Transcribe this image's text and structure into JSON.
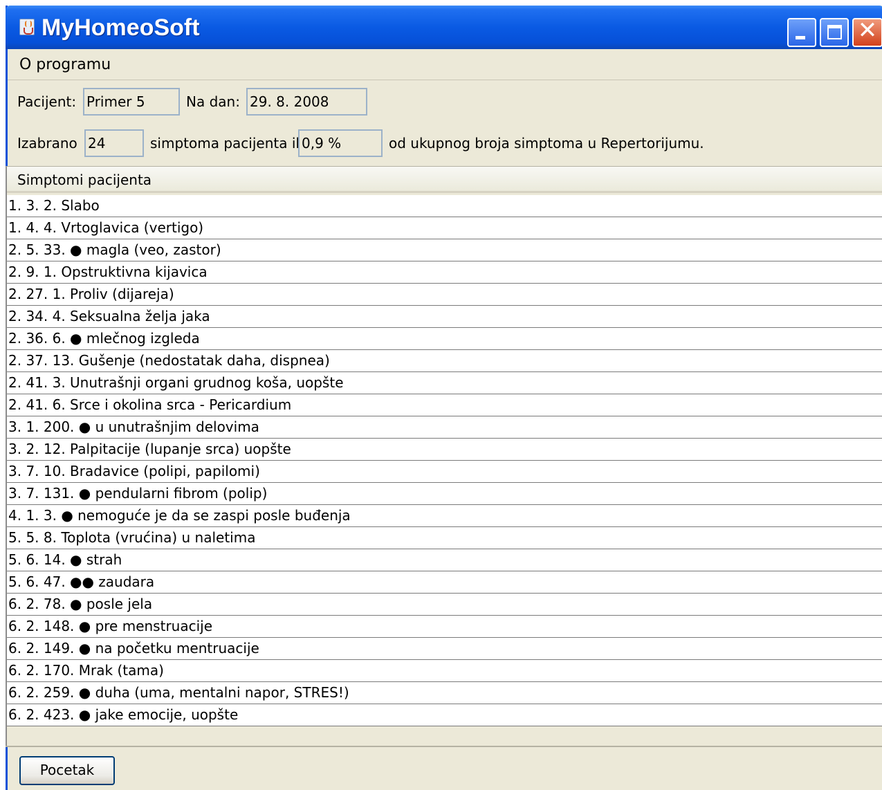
{
  "window": {
    "title": "MyHomeoSoft"
  },
  "menu": {
    "items": [
      "O programu"
    ]
  },
  "patient": {
    "label": "Pacijent:",
    "name": "Primer 5",
    "date_label": "Na dan:",
    "date": "29. 8. 2008"
  },
  "summary": {
    "label_selected": "Izabrano",
    "count": "24",
    "label_middle": "simptoma pacijenta ili",
    "percent": "0,9 %",
    "label_end": "od ukupnog broja simptoma u Repertorijumu."
  },
  "table": {
    "header": "Simptomi pacijenta",
    "rows": [
      "1. 3. 2. Slabo",
      "1. 4. 4. Vrtoglavica (vertigo)",
      "2. 5. 33. ● magla (veo, zastor)",
      "2. 9. 1. Opstruktivna kijavica",
      "2. 27. 1. Proliv (dijareja)",
      "2. 34. 4. Seksualna želja jaka",
      "2. 36. 6. ● mlečnog izgleda",
      "2. 37. 13. Gušenje (nedostatak daha, dispnea)",
      "2. 41. 3. Unutrašnji organi grudnog koša, uopšte",
      "2. 41. 6. Srce i okolina srca - Pericardium",
      "3. 1. 200. ● u unutrašnjim delovima",
      "3. 2. 12. Palpitacije (lupanje srca) uopšte",
      "3. 7. 10. Bradavice (polipi, papilomi)",
      "3. 7. 131. ● pendularni fibrom (polip)",
      "4. 1. 3. ● nemoguće je da se zaspi posle buđenja",
      "5. 5. 8. Toplota (vrućina) u naletima",
      "5. 6. 14. ● strah",
      "5. 6. 47. ●● zaudara",
      "6. 2. 78. ● posle jela",
      "6. 2. 148. ● pre menstruacije",
      "6. 2. 149. ● na početku mentruacije",
      "6. 2. 170. Mrak (tama)",
      "6. 2. 259. ● duha (uma, mentalni napor, STRES!)",
      "6. 2. 423. ● jake emocije, uopšte"
    ]
  },
  "footer": {
    "button_label": "Pocetak"
  }
}
